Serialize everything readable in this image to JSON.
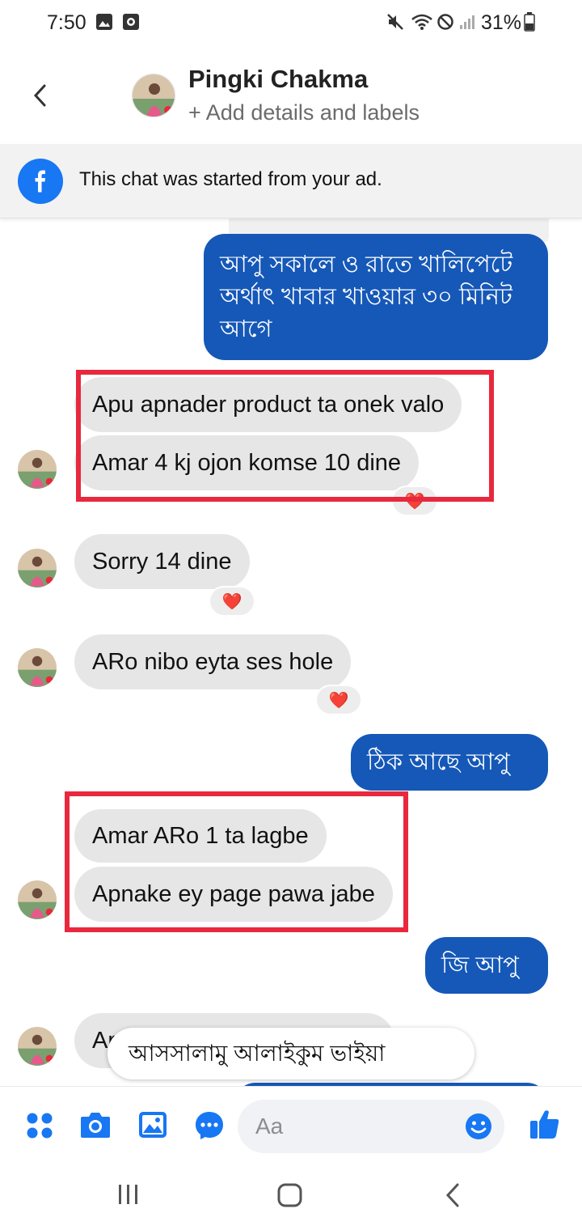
{
  "status_bar": {
    "time": "7:50",
    "battery": "31%"
  },
  "header": {
    "contact_name": "Pingki Chakma",
    "subtitle": "+ Add details and labels"
  },
  "ad_banner": {
    "text": "This chat was started from your ad."
  },
  "messages": [
    {
      "side": "out",
      "text": [
        "আপু সকালে ও রাতে খালিপেটে",
        "অর্থাৎ খাবার খাওয়ার ৩০ মিনিট",
        "আগে"
      ]
    },
    {
      "side": "in",
      "text": "Apu apnader product ta onek valo"
    },
    {
      "side": "in",
      "text": "Amar 4 kj ojon komse 10 dine",
      "reaction": "❤️"
    },
    {
      "side": "in",
      "text": "Sorry 14 dine",
      "reaction": "❤️"
    },
    {
      "side": "in",
      "text": "ARo nibo eyta ses hole",
      "reaction": "❤️"
    },
    {
      "side": "out",
      "text": "ঠিক আছে আপু"
    },
    {
      "side": "in",
      "text": "Amar ARo 1 ta lagbe"
    },
    {
      "side": "in",
      "text": "Apnake ey page pawa jabe"
    },
    {
      "side": "out",
      "text": "জি আপু"
    },
    {
      "side": "in",
      "text": "Ar"
    }
  ],
  "quick_reply": "আসসালামু আলাইকুম ভাইয়া",
  "composer": {
    "placeholder": "Aa"
  },
  "colors": {
    "outgoing_bubble": "#1558b8",
    "incoming_bubble": "#e6e6e6",
    "highlight": "#e8283d",
    "accent": "#1877f2"
  },
  "icons": [
    "back-arrow-icon",
    "facebook-icon",
    "apps-icon",
    "camera-icon",
    "gallery-icon",
    "chat-icon",
    "emoji-icon",
    "thumbs-up-icon",
    "recents-icon",
    "home-icon",
    "nav-back-icon"
  ]
}
